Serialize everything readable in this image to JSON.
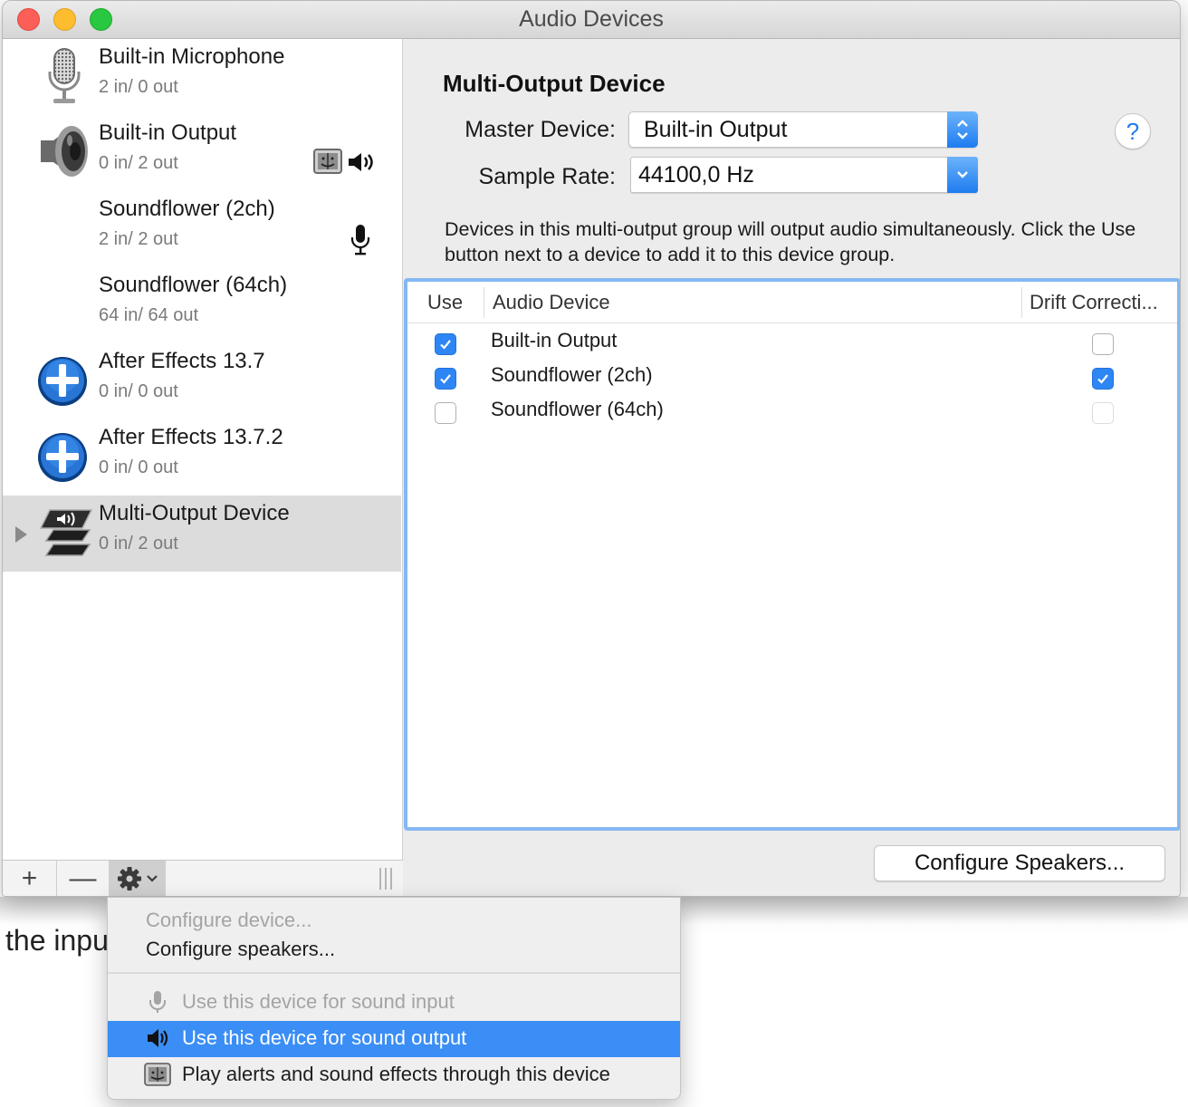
{
  "window": {
    "title": "Audio Devices"
  },
  "background": {
    "text": "the inpu"
  },
  "devices": [
    {
      "name": "Built-in Microphone",
      "io": "2 in/ 0 out",
      "icon": "microphone-icon"
    },
    {
      "name": "Built-in Output",
      "io": "0 in/ 2 out",
      "icon": "speaker-icon",
      "badges": [
        "finder-alert-icon",
        "sound-output-icon"
      ]
    },
    {
      "name": "Soundflower (2ch)",
      "io": "2 in/ 2 out",
      "icon": "none",
      "badges": [
        "sound-input-icon"
      ]
    },
    {
      "name": "Soundflower (64ch)",
      "io": "64 in/ 64 out",
      "icon": "none"
    },
    {
      "name": "After Effects 13.7",
      "io": "0 in/ 0 out",
      "icon": "plus-circle-icon"
    },
    {
      "name": "After Effects 13.7.2",
      "io": "0 in/ 0 out",
      "icon": "plus-circle-icon"
    },
    {
      "name": "Multi-Output Device",
      "io": "0 in/ 2 out",
      "icon": "multi-output-icon",
      "selected": true
    }
  ],
  "toolbar": {
    "add": "+",
    "remove": "—"
  },
  "panel": {
    "title": "Multi-Output Device",
    "master_label": "Master Device:",
    "master_value": "Built-in Output",
    "rate_label": "Sample Rate:",
    "rate_value": "44100,0 Hz",
    "help": "?",
    "description": "Devices in this multi-output group will output audio simultaneously. Click the Use button next to a device to add it to this device group.",
    "configure_button": "Configure Speakers..."
  },
  "table": {
    "headers": {
      "use": "Use",
      "device": "Audio Device",
      "drift": "Drift Correcti..."
    },
    "rows": [
      {
        "device": "Built-in Output",
        "use": true,
        "drift": false
      },
      {
        "device": "Soundflower (2ch)",
        "use": true,
        "drift": true
      },
      {
        "device": "Soundflower (64ch)",
        "use": false,
        "drift": false
      }
    ]
  },
  "menu": {
    "items": [
      {
        "label": "Configure device...",
        "disabled": true
      },
      {
        "label": "Configure speakers..."
      },
      {
        "label": "Use this device for sound input",
        "disabled": true,
        "icon": "microphone-icon"
      },
      {
        "label": "Use this device for sound output",
        "highlighted": true,
        "icon": "speaker-icon"
      },
      {
        "label": "Play alerts and sound effects through this device",
        "icon": "finder-alert-icon"
      }
    ]
  },
  "colors": {
    "accent": "#3b8ef6",
    "selection": "#dcdcdc",
    "table_focus": "#84b8f2"
  }
}
